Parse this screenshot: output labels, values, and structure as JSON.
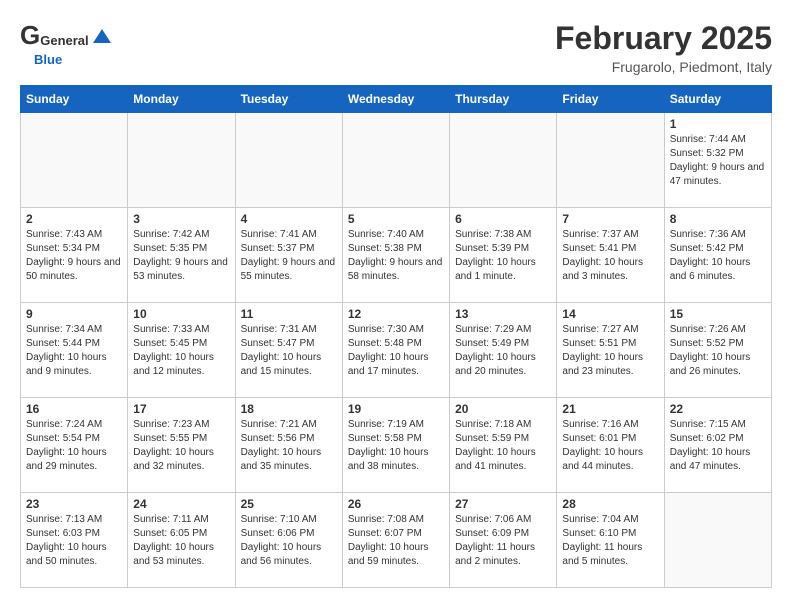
{
  "header": {
    "logo_general": "General",
    "logo_blue": "Blue",
    "month": "February 2025",
    "location": "Frugarolo, Piedmont, Italy"
  },
  "weekdays": [
    "Sunday",
    "Monday",
    "Tuesday",
    "Wednesday",
    "Thursday",
    "Friday",
    "Saturday"
  ],
  "weeks": [
    [
      {
        "day": "",
        "info": ""
      },
      {
        "day": "",
        "info": ""
      },
      {
        "day": "",
        "info": ""
      },
      {
        "day": "",
        "info": ""
      },
      {
        "day": "",
        "info": ""
      },
      {
        "day": "",
        "info": ""
      },
      {
        "day": "1",
        "info": "Sunrise: 7:44 AM\nSunset: 5:32 PM\nDaylight: 9 hours and 47 minutes."
      }
    ],
    [
      {
        "day": "2",
        "info": "Sunrise: 7:43 AM\nSunset: 5:34 PM\nDaylight: 9 hours and 50 minutes."
      },
      {
        "day": "3",
        "info": "Sunrise: 7:42 AM\nSunset: 5:35 PM\nDaylight: 9 hours and 53 minutes."
      },
      {
        "day": "4",
        "info": "Sunrise: 7:41 AM\nSunset: 5:37 PM\nDaylight: 9 hours and 55 minutes."
      },
      {
        "day": "5",
        "info": "Sunrise: 7:40 AM\nSunset: 5:38 PM\nDaylight: 9 hours and 58 minutes."
      },
      {
        "day": "6",
        "info": "Sunrise: 7:38 AM\nSunset: 5:39 PM\nDaylight: 10 hours and 1 minute."
      },
      {
        "day": "7",
        "info": "Sunrise: 7:37 AM\nSunset: 5:41 PM\nDaylight: 10 hours and 3 minutes."
      },
      {
        "day": "8",
        "info": "Sunrise: 7:36 AM\nSunset: 5:42 PM\nDaylight: 10 hours and 6 minutes."
      }
    ],
    [
      {
        "day": "9",
        "info": "Sunrise: 7:34 AM\nSunset: 5:44 PM\nDaylight: 10 hours and 9 minutes."
      },
      {
        "day": "10",
        "info": "Sunrise: 7:33 AM\nSunset: 5:45 PM\nDaylight: 10 hours and 12 minutes."
      },
      {
        "day": "11",
        "info": "Sunrise: 7:31 AM\nSunset: 5:47 PM\nDaylight: 10 hours and 15 minutes."
      },
      {
        "day": "12",
        "info": "Sunrise: 7:30 AM\nSunset: 5:48 PM\nDaylight: 10 hours and 17 minutes."
      },
      {
        "day": "13",
        "info": "Sunrise: 7:29 AM\nSunset: 5:49 PM\nDaylight: 10 hours and 20 minutes."
      },
      {
        "day": "14",
        "info": "Sunrise: 7:27 AM\nSunset: 5:51 PM\nDaylight: 10 hours and 23 minutes."
      },
      {
        "day": "15",
        "info": "Sunrise: 7:26 AM\nSunset: 5:52 PM\nDaylight: 10 hours and 26 minutes."
      }
    ],
    [
      {
        "day": "16",
        "info": "Sunrise: 7:24 AM\nSunset: 5:54 PM\nDaylight: 10 hours and 29 minutes."
      },
      {
        "day": "17",
        "info": "Sunrise: 7:23 AM\nSunset: 5:55 PM\nDaylight: 10 hours and 32 minutes."
      },
      {
        "day": "18",
        "info": "Sunrise: 7:21 AM\nSunset: 5:56 PM\nDaylight: 10 hours and 35 minutes."
      },
      {
        "day": "19",
        "info": "Sunrise: 7:19 AM\nSunset: 5:58 PM\nDaylight: 10 hours and 38 minutes."
      },
      {
        "day": "20",
        "info": "Sunrise: 7:18 AM\nSunset: 5:59 PM\nDaylight: 10 hours and 41 minutes."
      },
      {
        "day": "21",
        "info": "Sunrise: 7:16 AM\nSunset: 6:01 PM\nDaylight: 10 hours and 44 minutes."
      },
      {
        "day": "22",
        "info": "Sunrise: 7:15 AM\nSunset: 6:02 PM\nDaylight: 10 hours and 47 minutes."
      }
    ],
    [
      {
        "day": "23",
        "info": "Sunrise: 7:13 AM\nSunset: 6:03 PM\nDaylight: 10 hours and 50 minutes."
      },
      {
        "day": "24",
        "info": "Sunrise: 7:11 AM\nSunset: 6:05 PM\nDaylight: 10 hours and 53 minutes."
      },
      {
        "day": "25",
        "info": "Sunrise: 7:10 AM\nSunset: 6:06 PM\nDaylight: 10 hours and 56 minutes."
      },
      {
        "day": "26",
        "info": "Sunrise: 7:08 AM\nSunset: 6:07 PM\nDaylight: 10 hours and 59 minutes."
      },
      {
        "day": "27",
        "info": "Sunrise: 7:06 AM\nSunset: 6:09 PM\nDaylight: 11 hours and 2 minutes."
      },
      {
        "day": "28",
        "info": "Sunrise: 7:04 AM\nSunset: 6:10 PM\nDaylight: 11 hours and 5 minutes."
      },
      {
        "day": "",
        "info": ""
      }
    ]
  ]
}
